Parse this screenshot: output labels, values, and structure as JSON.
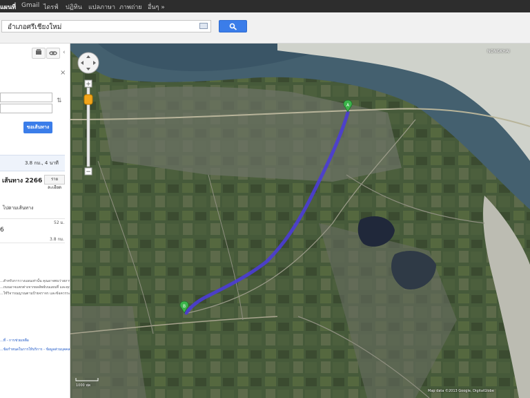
{
  "topbar": {
    "items": [
      {
        "label": "แผนที่",
        "active": true
      },
      {
        "label": "Gmail"
      },
      {
        "label": "ไดรฟ์"
      },
      {
        "label": "ปฏิทิน"
      },
      {
        "label": "แปลภาษา"
      },
      {
        "label": "ภาพถ่าย"
      },
      {
        "label": "อื่นๆ »"
      }
    ]
  },
  "search": {
    "query": "อำเภอศรีเชียงใหม่"
  },
  "panel": {
    "go_button": "ขอเส้นทาง",
    "summary": "3.8 กม., 4 นาที",
    "route_title": "เส้นทาง 2266",
    "detail_button": "รายละเอียด",
    "step_text": "ไปตามเส้นทาง",
    "step_number": "6",
    "dist_1": "52 ม.",
    "dist_2": "3.8 กม.",
    "disclaimer": [
      "...สำหรับการวางแผนเท่านั้น คุณอาจพบว่าสภาพการณ์",
      "...ถนนอาจแตกต่างจากผลลัพธ์บนแผนที่ และคุณควร",
      "...ใช้วิจารณญาณตามป้ายจราจร และข้อควรระวัง"
    ],
    "links": [
      "...ที่ - การช่วยเหลือ",
      "...ข้อกำหนดในการให้บริการ - ข้อมูลส่วนบุคคล"
    ]
  },
  "map": {
    "labels": [
      "NONGKHAI",
      "Map data ©2013 Google, DigitalGlobe",
      "1000 ฟุต"
    ],
    "route_color": "#4b3cd6",
    "marker_color": "#3cb44b"
  }
}
